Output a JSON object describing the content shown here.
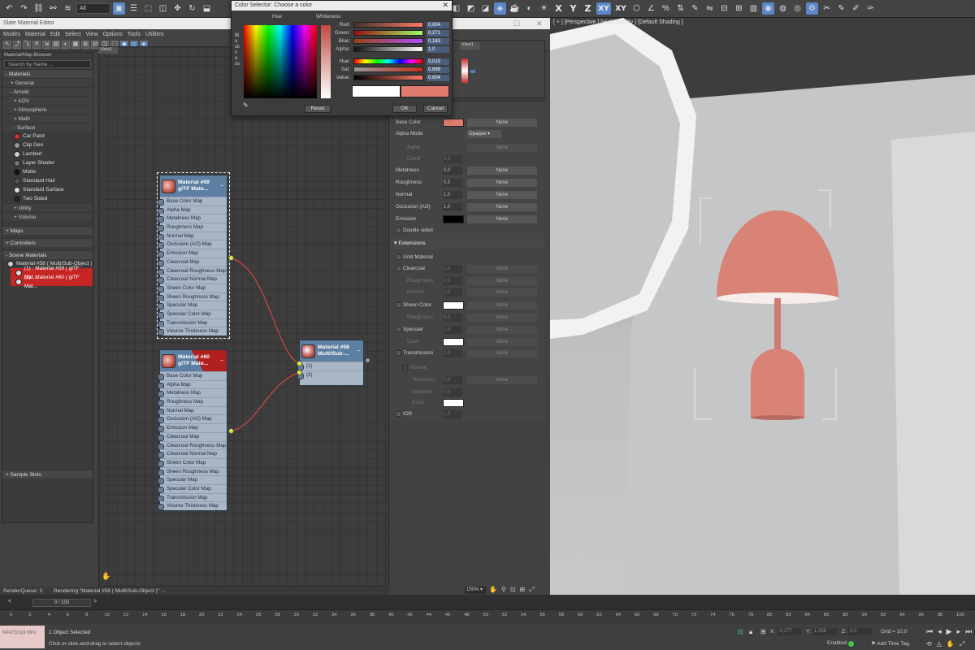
{
  "toolbar": {
    "selection_filter": "All",
    "axes": [
      "X",
      "Y",
      "Z",
      "XY",
      "XY"
    ]
  },
  "slate": {
    "title": "Slate Material Editor",
    "menu": [
      "Modes",
      "Material",
      "Edit",
      "Select",
      "View",
      "Options",
      "Tools",
      "Utilities"
    ],
    "view_tab": "View1",
    "view_tab_right": "View1"
  },
  "browser": {
    "header": "Material/Map Browser",
    "search_placeholder": "Search by Name ...",
    "materials_group": "- Materials",
    "general": "+ General",
    "arnold": "- Arnold",
    "aov": "+ AOV",
    "atmosphere": "+ Atmosphere",
    "math": "+ Math",
    "surface": "- Surface",
    "surface_items": [
      {
        "label": "Car Paint",
        "color": "#c83030"
      },
      {
        "label": "Clip Geo",
        "color": "#999999"
      },
      {
        "label": "Lambert",
        "color": "#d0d0d0"
      },
      {
        "label": "Layer Shader",
        "color": "#777777"
      },
      {
        "label": "Matte",
        "color": "#111111"
      },
      {
        "label": "Standard Hair",
        "color": "#555555"
      },
      {
        "label": "Standard Surface",
        "color": "#dddddd"
      },
      {
        "label": "Two Sided",
        "color": "#222222"
      }
    ],
    "utility": "+ Utility",
    "volume": "+ Volume",
    "maps": "+ Maps",
    "controllers": "+ Controllers",
    "scene_materials": "- Scene Materials",
    "scene_items": [
      "Material #58  ( Multi/Sub-Object )",
      "(1) : Material #59  ( glTF Mat...",
      "(2) : Material #60  ( glTF Mat..."
    ],
    "sample_slots": "+ Sample Slots"
  },
  "nodes": {
    "slot_labels": [
      "Base Color Map",
      "Alpha Map",
      "Metalness Map",
      "Roughness Map",
      "Normal Map",
      "Occlusion (AO) Map",
      "Emission Map",
      "Clearcoat Map",
      "Clearcoat Roughness Map",
      "Clearcoat Normal Map",
      "Sheen Color Map",
      "Sheen Roughness Map",
      "Specular Map",
      "Specular Color Map",
      "Transmission Map",
      "Volume Thickness Map"
    ],
    "m59_title": "Material #59",
    "m59_sub": "glTF Mate...",
    "m60_title": "Material #60",
    "m60_sub": "glTF Mate...",
    "m58_title": "Material #58",
    "m58_sub": "Multi/Sub-...",
    "m58_slots": [
      "(1)",
      "(2)"
    ]
  },
  "props": {
    "base_color": "Base Color",
    "base_color_value": "#e07a6e",
    "none": "None",
    "alpha_mode": "Alpha Mode",
    "alpha_mode_value": "Opaque",
    "alpha": "Alpha",
    "cutoff": "Cutoff",
    "cutoff_value": "0,5",
    "metalness": "Metalness",
    "metalness_value": "0,0",
    "roughness": "Roughness",
    "roughness_value": "0,5",
    "normal": "Normal",
    "normal_value": "1,0",
    "occlusion": "Occlusion (AO)",
    "occlusion_value": "1,0",
    "emission": "Emission",
    "double_sided": "Double sided",
    "extensions": "Extensions",
    "unlit": "Unlit Material",
    "clearcoat": "Clearcoat",
    "clearcoat_value": "1,0",
    "cc_roughness": "Roughness",
    "cc_roughness_value": "0,0",
    "cc_normal": "Normal",
    "cc_normal_value": "1,0",
    "sheen_color": "Sheen Color",
    "sheen_roughness": "Roughness",
    "sheen_roughness_value": "0,0",
    "specular": "Specular",
    "specular_value": "1,0",
    "spec_color": "Color",
    "transmission": "Transmission",
    "transmission_value": "1,0",
    "volume": "Volume",
    "thickness": "Thickness",
    "thickness_value": "0,0",
    "distance": "Distance",
    "distance_value": "0,0",
    "vol_color": "Color",
    "ior": "IOR",
    "ior_value": "1,5"
  },
  "color_selector": {
    "title": "Color Selector: Choose a color",
    "hue_label": "Hue",
    "whiteness_label": "Whiteness",
    "blackness_label": "Blackness",
    "red_label": "Red:",
    "red_value": "0,604",
    "green_label": "Green:",
    "green_value": "0,271",
    "blue_label": "Blue:",
    "blue_value": "0,183",
    "alpha_label": "Alpha:",
    "alpha_value": "1,0",
    "hue2_label": "Hue:",
    "hue2_value": "0,015",
    "sat_label": "Sat:",
    "sat_value": "0,698",
    "value_label": "Value:",
    "value_value": "0,604",
    "reset": "Reset",
    "ok": "OK",
    "cancel": "Cancel",
    "old_color": "#ffffff",
    "new_color": "#e07a6e"
  },
  "viewport": {
    "label": "[ + ] [Perspective ] [High Quality ] [Default Shading ]",
    "lamp_color": "#d98276"
  },
  "bottom": {
    "render_queue": "RenderQueue: 3",
    "rendering": "Rendering \"Material #58 ( Multi/Sub-Object )\" ...",
    "zoom": "150%",
    "frames": "0 / 100",
    "ticks": [
      "0",
      "2",
      "4",
      "6",
      "8",
      "10",
      "12",
      "14",
      "16",
      "18",
      "20",
      "22",
      "24",
      "26",
      "28",
      "30",
      "32",
      "34",
      "36",
      "38",
      "40",
      "42",
      "44",
      "46",
      "48",
      "50",
      "52",
      "54",
      "56",
      "58",
      "60",
      "62",
      "64",
      "66",
      "68",
      "70",
      "72",
      "74",
      "76",
      "78",
      "80",
      "82",
      "84",
      "86",
      "88",
      "90",
      "92",
      "94",
      "96",
      "98",
      "100"
    ],
    "maxscript": "MAXScript Mini",
    "selected": "1 Object Selected",
    "hint": "Click or click-and-drag to select objects",
    "x_label": "X:",
    "x_value": "-0,277",
    "y_label": "Y:",
    "y_value": "1,356",
    "z_label": "Z:",
    "z_value": "0,0",
    "grid": "Grid = 10,0",
    "enabled": "Enabled:",
    "add_time_tag": "Add Time Tag"
  }
}
